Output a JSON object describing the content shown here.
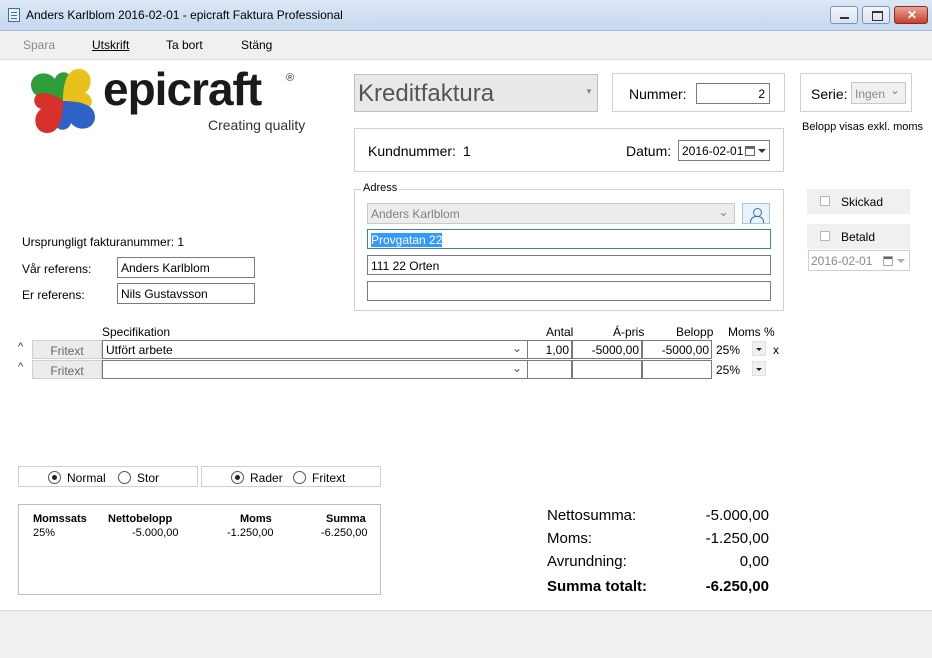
{
  "window": {
    "title": "Anders Karlblom 2016-02-01 - epicraft Faktura Professional"
  },
  "toolbar": {
    "spara": "Spara",
    "utskrift": "Utskrift",
    "ta_bort": "Ta bort",
    "stang": "Stäng"
  },
  "logo": {
    "word": "epicraft",
    "reg": "®",
    "tagline": "Creating quality"
  },
  "header": {
    "doc_type": "Kreditfaktura",
    "nummer_label": "Nummer:",
    "nummer_value": "2",
    "serie_label": "Serie:",
    "serie_value": "Ingen",
    "belopp_note": "Belopp visas exkl. moms",
    "kundnummer_label": "Kundnummer:",
    "kundnummer_value": "1",
    "datum_label": "Datum:",
    "datum_value": "2016-02-01"
  },
  "address": {
    "legend": "Adress",
    "name": "Anders Karlblom",
    "line1": "Provgatan 22",
    "line2": "111 22 Orten",
    "line3": ""
  },
  "status": {
    "skickad": "Skickad",
    "betald": "Betald",
    "betald_date": "2016-02-01"
  },
  "refs": {
    "orig_invoice": "Ursprungligt fakturanummer: 1",
    "var_ref_label": "Vår referens:",
    "var_ref_value": "Anders Karlblom",
    "er_ref_label": "Er referens:",
    "er_ref_value": "Nils Gustavsson"
  },
  "lines": {
    "headers": {
      "spec": "Specifikation",
      "antal": "Antal",
      "apris": "Á-pris",
      "belopp": "Belopp",
      "moms": "Moms %"
    },
    "rows": [
      {
        "caret": "^",
        "type_btn": "Fritext",
        "spec": "Utfört arbete",
        "antal": "1,00",
        "apris": "-5000,00",
        "belopp": "-5000,00",
        "moms": "25%",
        "delete": "x"
      },
      {
        "caret": "^",
        "type_btn": "Fritext",
        "spec": "",
        "antal": "",
        "apris": "",
        "belopp": "",
        "moms": "25%",
        "delete": ""
      }
    ]
  },
  "view_options": {
    "size": {
      "normal": "Normal",
      "stor": "Stor",
      "selected": "Normal"
    },
    "mode": {
      "rader": "Rader",
      "fritext": "Fritext",
      "selected": "Rader"
    }
  },
  "vat_summary": {
    "headers": [
      "Momssats",
      "Nettobelopp",
      "Moms",
      "Summa"
    ],
    "rows": [
      [
        "25%",
        "-5.000,00",
        "-1.250,00",
        "-6.250,00"
      ]
    ]
  },
  "totals": {
    "netto_label": "Nettosumma:",
    "netto_value": "-5.000,00",
    "moms_label": "Moms:",
    "moms_value": "-1.250,00",
    "avrundning_label": "Avrundning:",
    "avrundning_value": "0,00",
    "summa_label": "Summa totalt:",
    "summa_value": "-6.250,00"
  },
  "colors": {
    "selection": "#3399ff",
    "titlebar": "#c6d8ef",
    "close": "#c8402b"
  }
}
